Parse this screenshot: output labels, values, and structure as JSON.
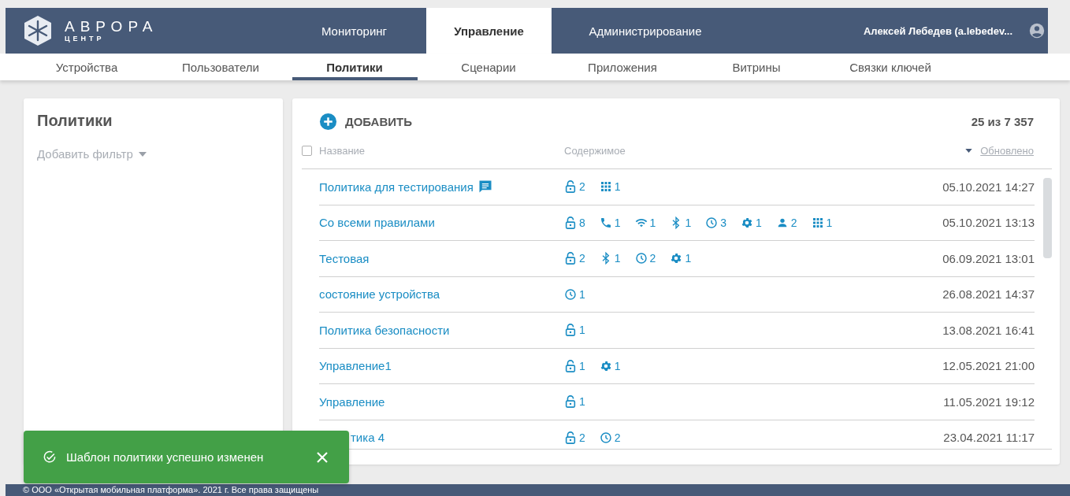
{
  "logo": {
    "title": "АВРОРА",
    "subtitle": "ЦЕНТР"
  },
  "nav": [
    {
      "label": "Мониторинг",
      "selected": false
    },
    {
      "label": "Управление",
      "selected": true
    },
    {
      "label": "Администрирование",
      "selected": false
    }
  ],
  "user": {
    "name": "Алексей Лебедев (a.lebedev..."
  },
  "subnav": [
    {
      "label": "Устройства",
      "selected": false
    },
    {
      "label": "Пользователи",
      "selected": false
    },
    {
      "label": "Политики",
      "selected": true
    },
    {
      "label": "Сценарии",
      "selected": false
    },
    {
      "label": "Приложения",
      "selected": false
    },
    {
      "label": "Витрины",
      "selected": false
    },
    {
      "label": "Связки ключей",
      "selected": false
    }
  ],
  "filters": {
    "title": "Политики",
    "add_filter": "Добавить фильтр"
  },
  "table": {
    "add_button": "ДОБАВИТЬ",
    "count": "25 из 7 357",
    "select_all": {
      "checked": false
    },
    "columns": [
      "Название",
      "Содержимое",
      "Обновлено"
    ],
    "rows": [
      {
        "kind": "full",
        "name": "Политика для тестирования",
        "comment": true,
        "content": [
          {
            "kind": "lock",
            "count": "2"
          },
          {
            "kind": "apps",
            "count": "1"
          }
        ],
        "updated": "05.10.2021 14:27"
      },
      {
        "kind": "full",
        "name": "Со всеми правилами",
        "comment": false,
        "content": [
          {
            "kind": "lock",
            "count": "8"
          },
          {
            "kind": "phone",
            "count": "1"
          },
          {
            "kind": "wifi",
            "count": "1"
          },
          {
            "kind": "bluetooth",
            "count": "1"
          },
          {
            "kind": "clock",
            "count": "3"
          },
          {
            "kind": "gear",
            "count": "1"
          },
          {
            "kind": "person",
            "count": "2"
          },
          {
            "kind": "apps",
            "count": "1"
          }
        ],
        "updated": "05.10.2021 13:13"
      },
      {
        "kind": "full",
        "name": "Тестовая",
        "comment": false,
        "content": [
          {
            "kind": "lock",
            "count": "2"
          },
          {
            "kind": "bluetooth",
            "count": "1"
          },
          {
            "kind": "clock",
            "count": "2"
          },
          {
            "kind": "gear",
            "count": "1"
          }
        ],
        "updated": "06.09.2021 13:01"
      },
      {
        "kind": "full",
        "name": "состояние устройства",
        "comment": false,
        "content": [
          {
            "kind": "clock",
            "count": "1"
          }
        ],
        "updated": "26.08.2021 14:37"
      },
      {
        "kind": "full",
        "name": "Политика безопасности",
        "comment": false,
        "content": [
          {
            "kind": "lock",
            "count": "1"
          }
        ],
        "updated": "13.08.2021 16:41"
      },
      {
        "kind": "full",
        "name": "Управление1",
        "comment": false,
        "content": [
          {
            "kind": "lock",
            "count": "1"
          },
          {
            "kind": "gear",
            "count": "1"
          }
        ],
        "updated": "12.05.2021 21:00"
      },
      {
        "kind": "full",
        "name": "Управление",
        "comment": false,
        "content": [
          {
            "kind": "lock",
            "count": "1"
          }
        ],
        "updated": "11.05.2021 19:12"
      },
      {
        "kind": "covered",
        "name": "тика 4",
        "comment": false,
        "content": [
          {
            "kind": "lock",
            "count": "2"
          },
          {
            "kind": "clock",
            "count": "2"
          }
        ],
        "updated": "23.04.2021 11:17"
      }
    ]
  },
  "toast": {
    "message": "Шаблон политики успешно изменен"
  },
  "footer": {
    "text": "© ООО «Открытая мобильная платформа». 2021 г. Все права защищены"
  }
}
